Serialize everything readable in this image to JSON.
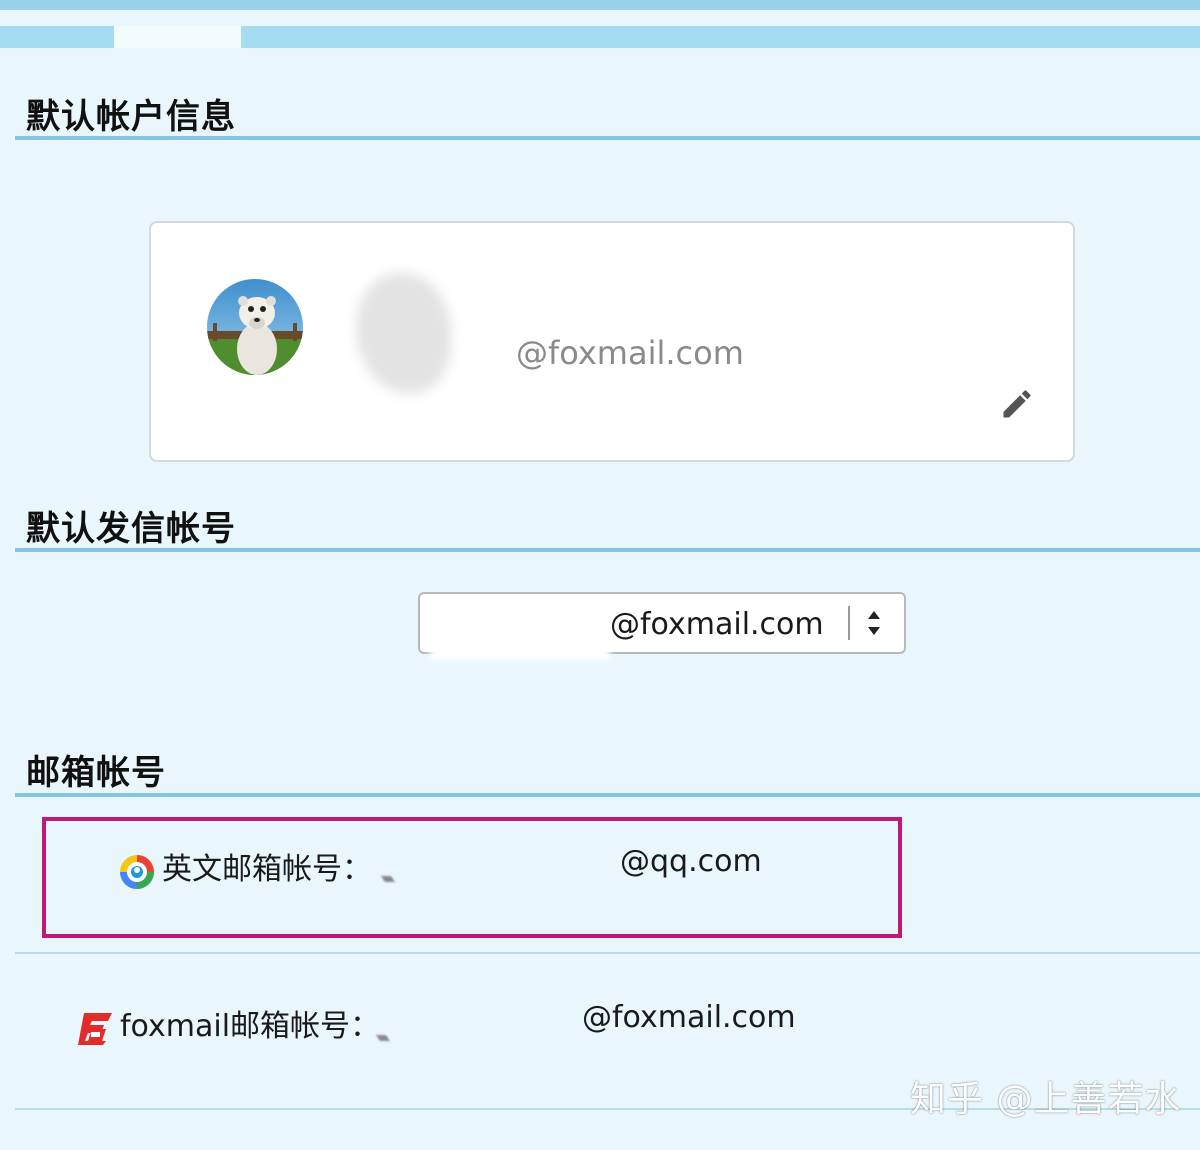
{
  "sections": {
    "default_account_info": "默认帐户信息",
    "default_sender": "默认发信帐号",
    "mailbox_accounts": "邮箱帐号"
  },
  "account_card": {
    "email": "@foxmail.com",
    "edit_icon": "pencil-icon"
  },
  "sender_select": {
    "value": "@foxmail.com",
    "arrows_icon": "updown-arrows-icon"
  },
  "accounts": [
    {
      "icon": "qq-mail-icon",
      "label": "英文邮箱帐号：",
      "value": "@qq.com",
      "highlighted": true
    },
    {
      "icon": "foxmail-icon",
      "label": "foxmail邮箱帐号：",
      "value": "@foxmail.com",
      "highlighted": false
    }
  ],
  "watermark": "知乎 @上善若水",
  "colors": {
    "background": "#e9f7fd",
    "rule": "#86c4e2",
    "highlight": "#c2177a",
    "foxmail_red": "#e32b2b"
  }
}
